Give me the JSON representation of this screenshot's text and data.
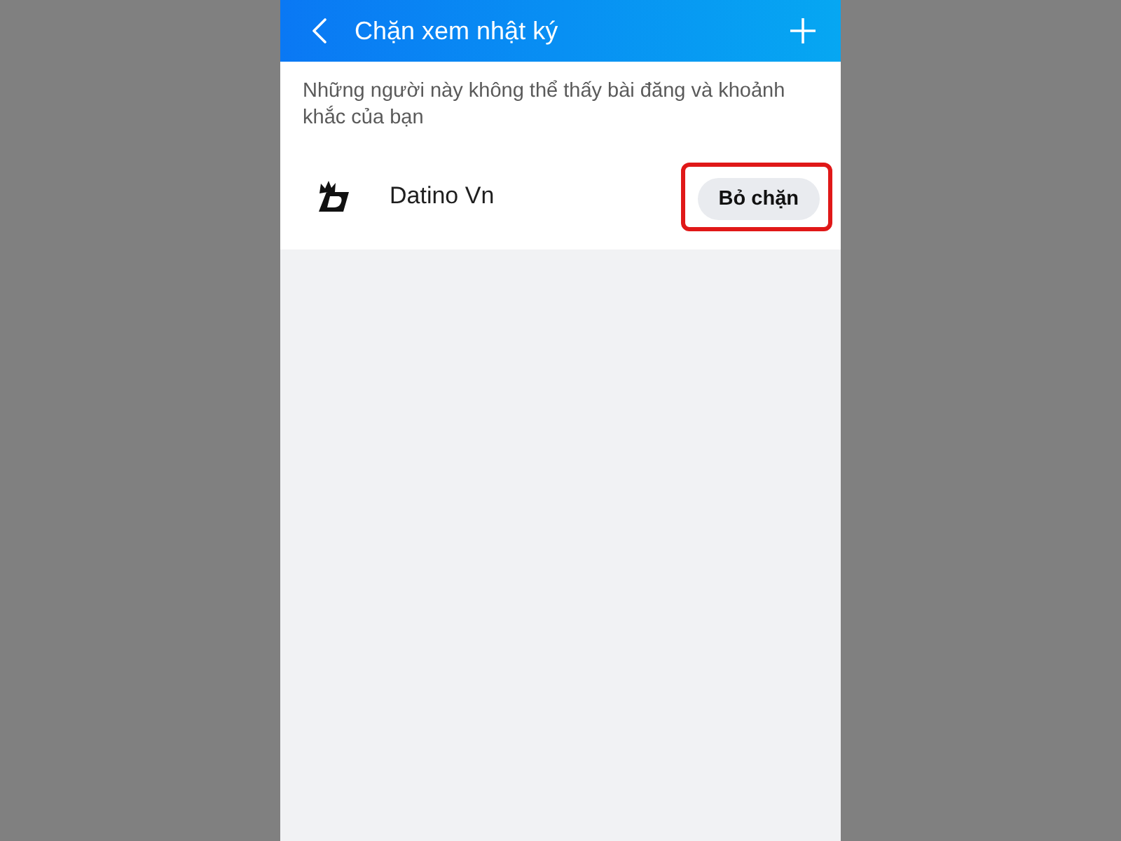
{
  "header": {
    "title": "Chặn xem nhật ký"
  },
  "description": "Những người này không thể thấy bài đăng và khoảnh khắc của bạn",
  "blocked_users": [
    {
      "name": "Datino Vn",
      "button": {
        "label": "Bỏ chặn",
        "highlighted": true
      }
    }
  ]
}
